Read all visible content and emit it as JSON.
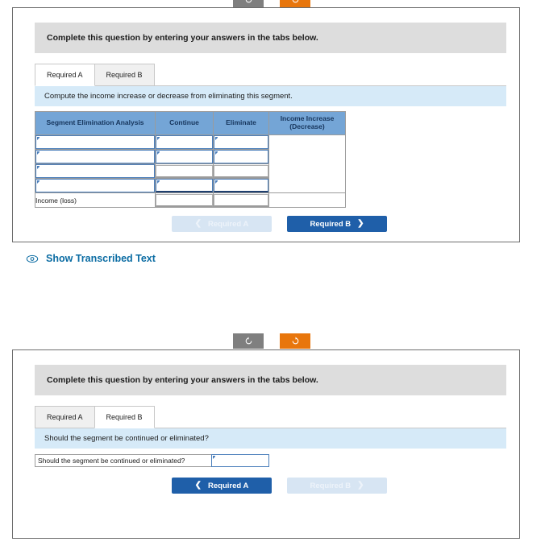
{
  "toolbar": {
    "undo": {
      "icon": "undo-arrow-icon",
      "label": "↺",
      "color": "#7f7f7f"
    },
    "redo": {
      "icon": "redo-arrow-icon",
      "label": "↻",
      "color": "#e8760c"
    }
  },
  "panel1": {
    "instruction": "Complete this question by entering your answers in the tabs below.",
    "tabs": [
      {
        "label": "Required A",
        "active": true
      },
      {
        "label": "Required B",
        "active": false
      }
    ],
    "question": "Compute the income increase or decrease from eliminating this segment.",
    "table": {
      "headers": [
        "Segment Elimination Analysis",
        "Continue",
        "Eliminate",
        "Income Increase (Decrease)"
      ],
      "header_income_line1": "Income Increase",
      "header_income_line2": "(Decrease)",
      "rows": [
        {
          "label": "",
          "continue": "",
          "eliminate": "",
          "income": ""
        },
        {
          "label": "",
          "continue": "",
          "eliminate": "",
          "income": ""
        },
        {
          "label": "",
          "continue": "",
          "eliminate": "",
          "income": ""
        },
        {
          "label": "",
          "continue": "",
          "eliminate": "",
          "income": ""
        }
      ],
      "total_row": {
        "label": "Income (loss)",
        "continue": "",
        "eliminate": "",
        "income": ""
      }
    },
    "nav": {
      "prev": {
        "label": "Required A",
        "chevron": "❮",
        "enabled": false
      },
      "next": {
        "label": "Required B",
        "chevron": "❯",
        "enabled": true
      }
    }
  },
  "transcribed": {
    "icon": "eye-icon",
    "label": "Show Transcribed Text",
    "color": "#0b6ca3"
  },
  "panel2": {
    "instruction": "Complete this question by entering your answers in the tabs below.",
    "tabs": [
      {
        "label": "Required A",
        "active": false
      },
      {
        "label": "Required B",
        "active": true
      }
    ],
    "question": "Should the segment be continued or eliminated?",
    "answer": {
      "label": "Should the segment be continued or eliminated?",
      "value": "",
      "placeholder": ""
    },
    "nav": {
      "prev": {
        "label": "Required A",
        "chevron": "❮",
        "enabled": true
      },
      "next": {
        "label": "Required B",
        "chevron": "❯",
        "enabled": false
      }
    }
  },
  "colors": {
    "header_gray": "#dddddd",
    "question_blue": "#d6eaf8",
    "table_header_blue": "#74a5d6",
    "primary_button": "#1f5fa9",
    "disabled_button": "#d7e5f3",
    "orange": "#e8760c",
    "gray_tool": "#7f7f7f",
    "link_teal": "#0b6ca3"
  }
}
